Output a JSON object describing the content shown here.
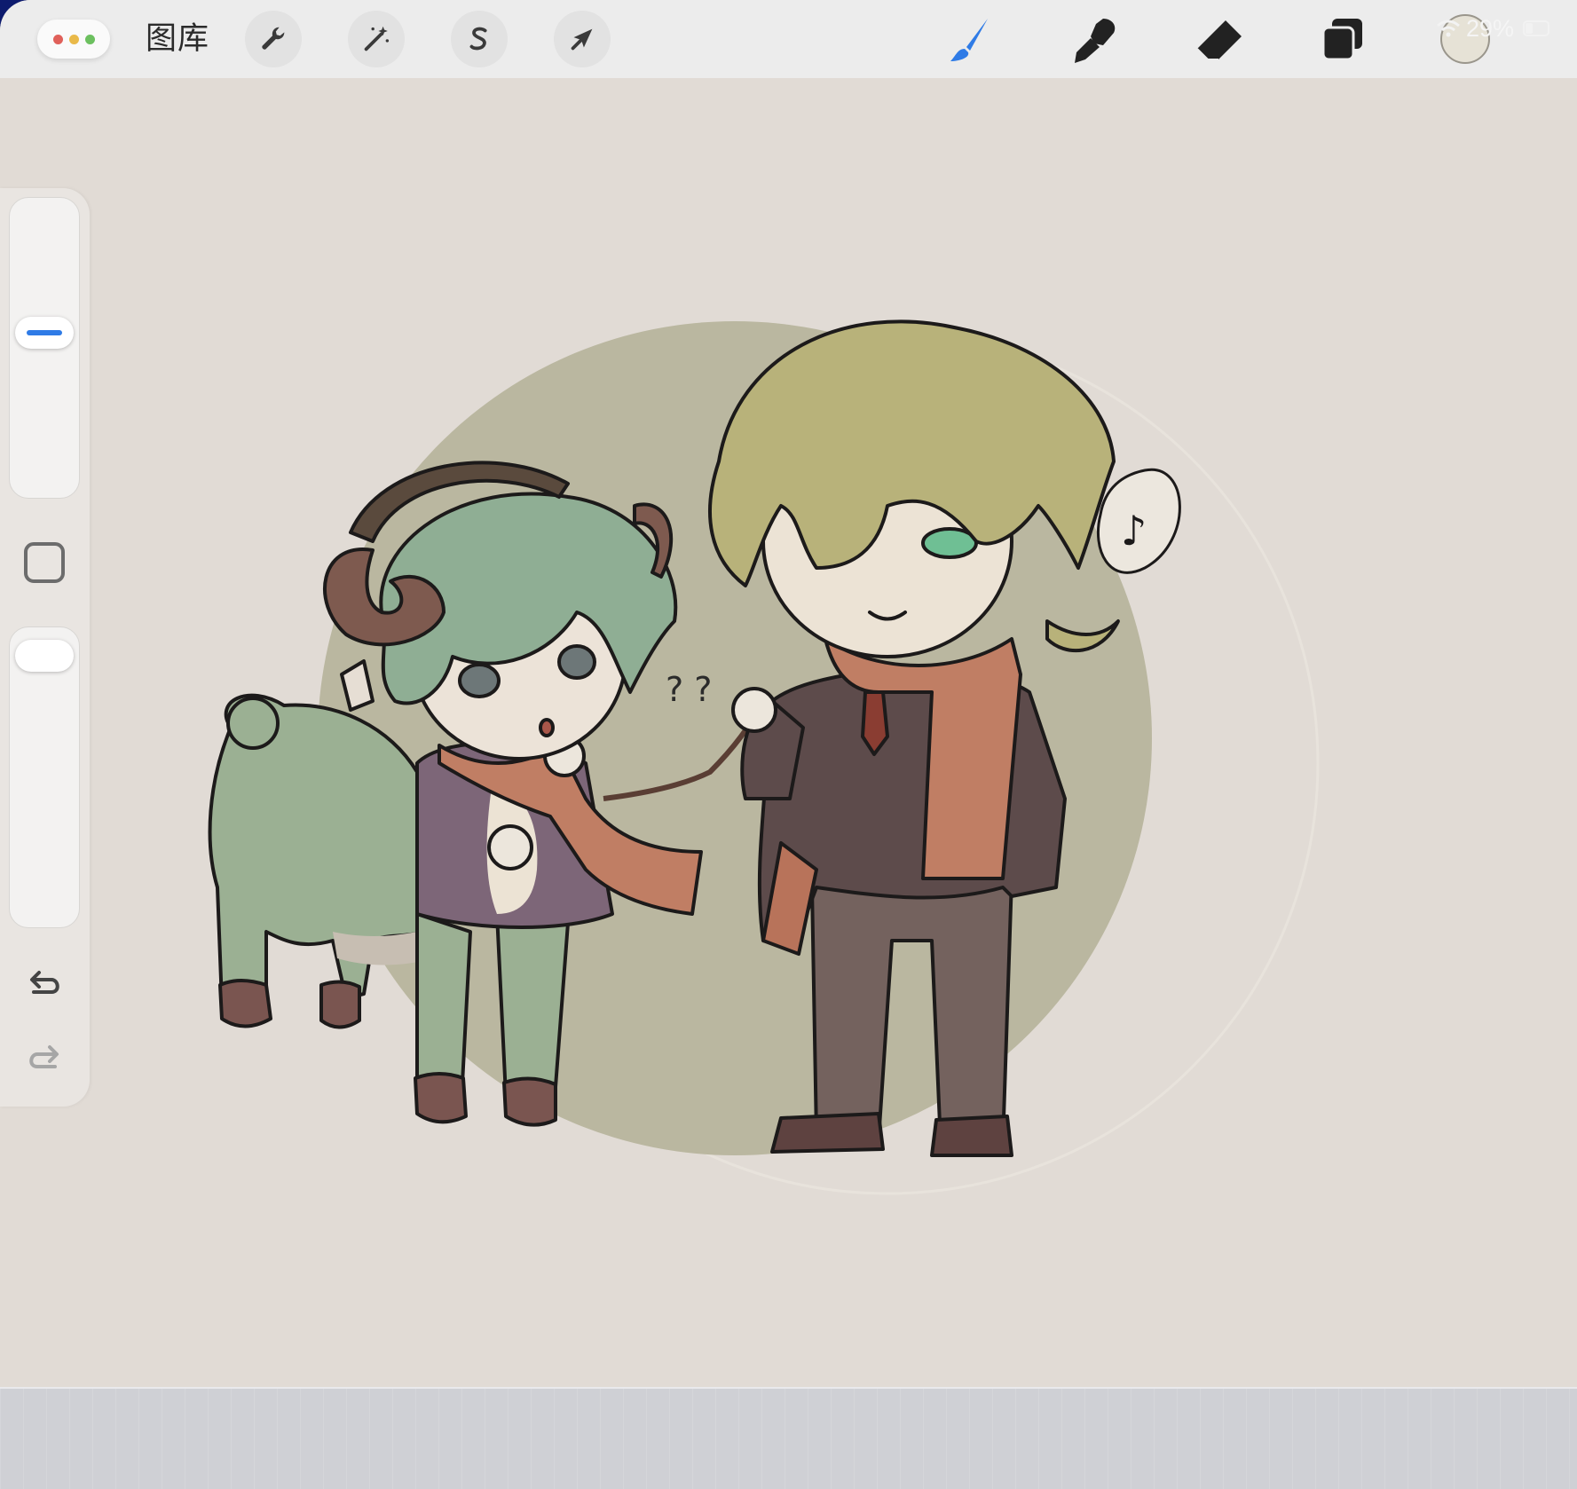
{
  "toolbar": {
    "window_controls": {
      "dot_colors": [
        "#e0605a",
        "#e9b949",
        "#6cc05f"
      ]
    },
    "gallery_label": "图库",
    "actions": [
      {
        "id": "actions",
        "icon": "wrench-icon"
      },
      {
        "id": "adjustments",
        "icon": "magic-wand-icon"
      },
      {
        "id": "selection",
        "icon": "selection-s-icon"
      },
      {
        "id": "transform",
        "icon": "arrow-cursor-icon"
      }
    ],
    "paint_tools": [
      {
        "id": "brush",
        "icon": "brush-icon",
        "active": true,
        "color": "#2f7be6"
      },
      {
        "id": "smudge",
        "icon": "smudge-icon",
        "active": false,
        "color": "#222222"
      },
      {
        "id": "eraser",
        "icon": "eraser-icon",
        "active": false,
        "color": "#222222"
      },
      {
        "id": "layers",
        "icon": "layers-icon",
        "active": false,
        "color": "#222222"
      }
    ],
    "current_color": "#e6e2d6"
  },
  "status_bar": {
    "battery_percent": "29%",
    "wifi_icon": "wifi-icon",
    "battery_icon": "battery-icon"
  },
  "sidebar": {
    "brush_size": {
      "icon": "size-slider-handle",
      "accent": "#2f7be6",
      "level": 0.45
    },
    "modify_button": {
      "icon": "square-modify-icon"
    },
    "brush_opacity": {
      "icon": "opacity-slider-handle",
      "level": 0.95
    },
    "undo": {
      "icon": "undo-icon"
    },
    "redo": {
      "icon": "redo-icon"
    }
  },
  "canvas": {
    "background_color": "#e1dbd5",
    "circle_color": "#bab7a0",
    "artwork": "chibi-illustration",
    "speech_bubble_text": "♪",
    "question_marks": "? ?"
  }
}
